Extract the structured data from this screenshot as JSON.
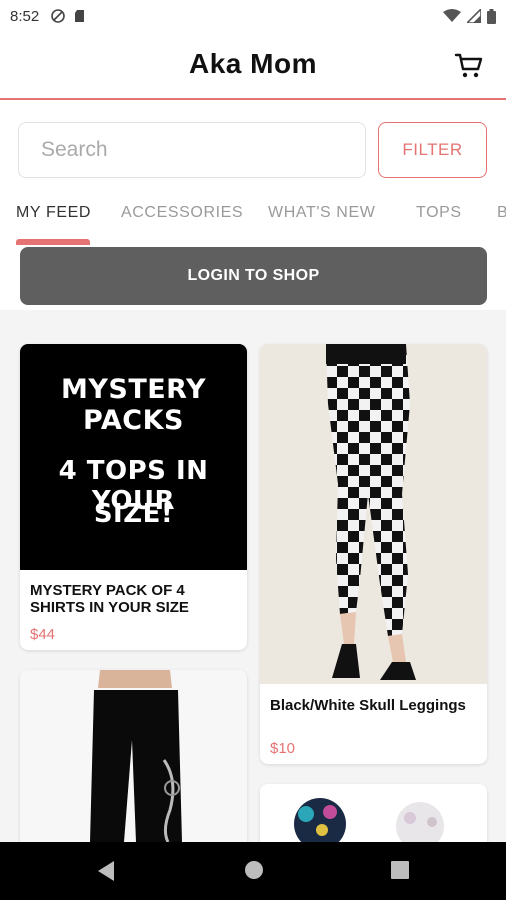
{
  "status_bar": {
    "time": "8:52",
    "left_icons": [
      "do-not-disturb-icon",
      "sd-card-icon"
    ],
    "right_icons": [
      "wifi-icon",
      "signal-icon",
      "battery-icon"
    ]
  },
  "header": {
    "title": "Aka Mom",
    "cart_icon": "cart-icon"
  },
  "search": {
    "placeholder": "Search",
    "filter_label": "FILTER"
  },
  "tabs": [
    {
      "label": "MY FEED",
      "active": true
    },
    {
      "label": "ACCESSORIES",
      "active": false
    },
    {
      "label": "WHAT'S NEW",
      "active": false
    },
    {
      "label": "TOPS",
      "active": false
    },
    {
      "label": "B",
      "active": false
    }
  ],
  "login_button": "LOGIN TO SHOP",
  "products": [
    {
      "image_text_line1": "MYSTERY PACKS",
      "image_text_line2": "4 TOPS IN YOUR",
      "image_text_line3": "SIZE!",
      "name": "MYSTERY PACK OF 4 SHIRTS IN YOUR SIZE",
      "price": "$44"
    },
    {
      "name": "Black/White Skull Leggings",
      "price": "$10"
    },
    {
      "name": "",
      "price": ""
    },
    {
      "name": "",
      "price": ""
    }
  ],
  "colors": {
    "accent": "#e57373",
    "login_bg": "#5f5f5f",
    "background": "#f4f4f4"
  },
  "nav_bar": [
    "back-icon",
    "home-icon",
    "recents-icon"
  ]
}
